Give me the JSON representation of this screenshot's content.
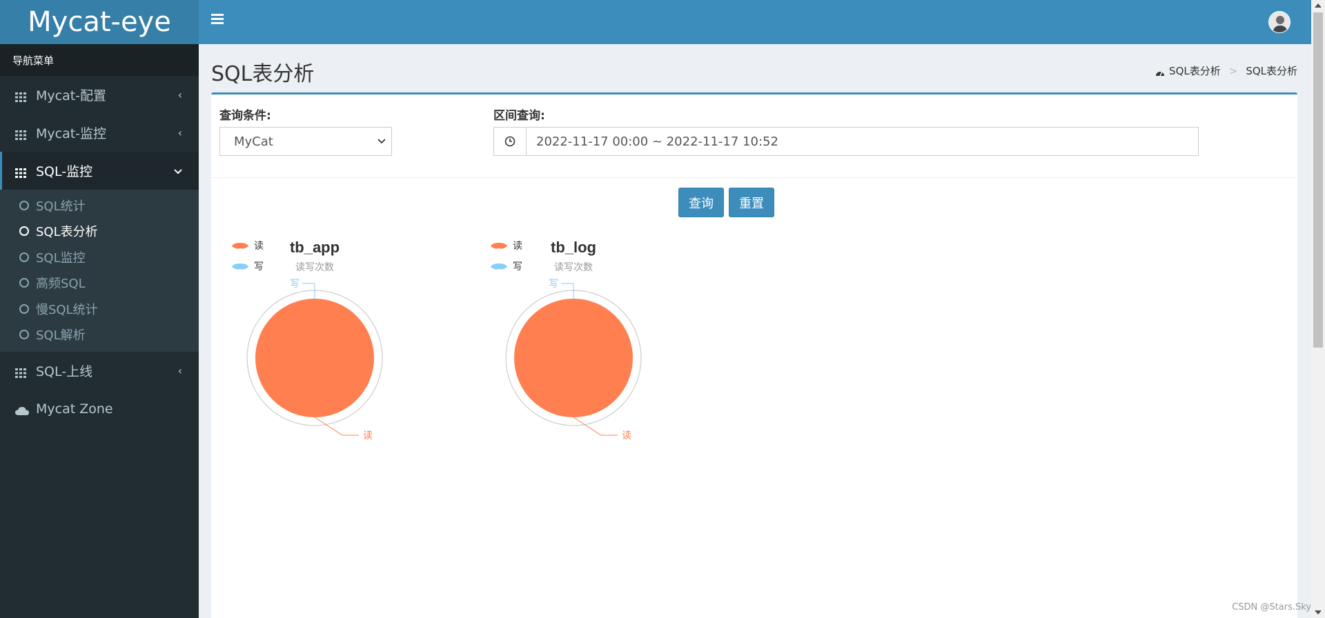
{
  "app": {
    "logo": "Mycat-eye"
  },
  "sidebar": {
    "header": "导航菜单",
    "items": [
      {
        "label": "Mycat-配置",
        "icon": "grid-icon",
        "arrow": "‹"
      },
      {
        "label": "Mycat-监控",
        "icon": "grid-icon",
        "arrow": "‹"
      },
      {
        "label": "SQL-监控",
        "icon": "grid-icon",
        "arrow": "⌄"
      },
      {
        "label": "SQL-上线",
        "icon": "grid-icon",
        "arrow": "‹"
      },
      {
        "label": "Mycat Zone",
        "icon": "cloud-icon"
      }
    ],
    "submenu": [
      {
        "label": "SQL统计"
      },
      {
        "label": "SQL表分析"
      },
      {
        "label": "SQL监控"
      },
      {
        "label": "高频SQL"
      },
      {
        "label": "慢SQL统计"
      },
      {
        "label": "SQL解析"
      }
    ]
  },
  "page": {
    "title": "SQL表分析",
    "breadcrumb": [
      "SQL表分析",
      "SQL表分析"
    ],
    "breadcrumb_sep": ">"
  },
  "filters": {
    "condition_label": "查询条件:",
    "condition_value": "MyCat",
    "range_label": "区间查询:",
    "range_value": "2022-11-17 00:00 ~ 2022-11-17 10:52"
  },
  "buttons": {
    "query": "查询",
    "reset": "重置"
  },
  "colors": {
    "read": "#ff7f50",
    "write": "#87cefa",
    "accent": "#3c8dbc"
  },
  "chart_data": [
    {
      "type": "pie",
      "title": "tb_app",
      "subtitle": "读写次数",
      "legend": [
        "读",
        "写"
      ],
      "labels": [
        "读",
        "写"
      ],
      "values": [
        1,
        0
      ],
      "legend_position": "top-left"
    },
    {
      "type": "pie",
      "title": "tb_log",
      "subtitle": "读写次数",
      "legend": [
        "读",
        "写"
      ],
      "labels": [
        "读",
        "写"
      ],
      "values": [
        1,
        0
      ],
      "legend_position": "top-left"
    }
  ],
  "watermark": "CSDN @Stars.Sky"
}
